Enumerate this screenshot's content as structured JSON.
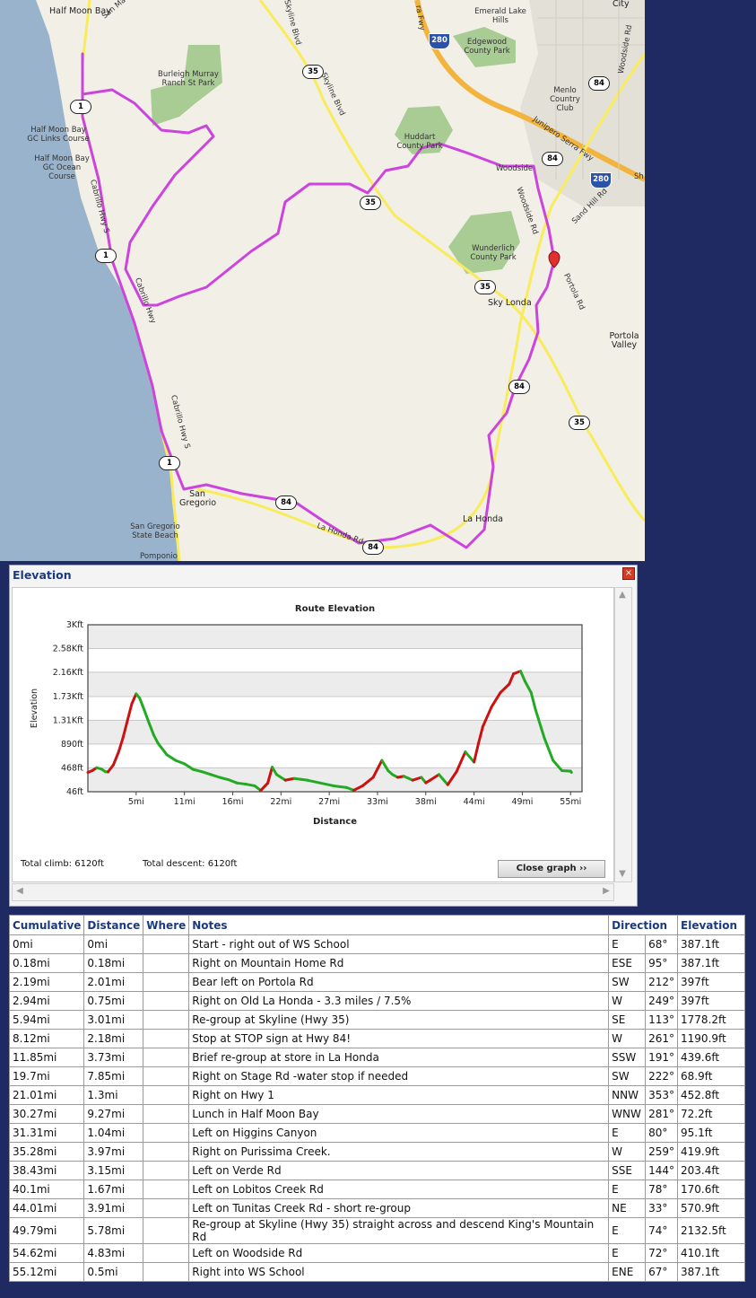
{
  "map": {
    "labels": {
      "half_moon_bay": "Half Moon Bay",
      "burleigh": "Burleigh Murray Ranch St Park",
      "hmb_gc_links": "Half Moon Bay GC Links Course",
      "hmb_gc_ocean": "Half Moon Bay GC Ocean Course",
      "emerald_lake_hills": "Emerald Lake Hills",
      "edgewood": "Edgewood County Park",
      "menlo_cc": "Menlo Country Club",
      "huddart": "Huddart County Park",
      "woodside": "Woodside",
      "wunderlich": "Wunderlich County Park",
      "sky_londa": "Sky Londa",
      "portola_valley": "Portola Valley",
      "san_gregorio": "San Gregorio",
      "sg_state_beach": "San Gregorio State Beach",
      "la_honda": "La Honda",
      "pomponio": "Pomponio",
      "city": "City",
      "sh": "Sh",
      "skyline_blvd": "Skyline Blvd",
      "woodside_rd": "Woodside Rd",
      "sand_hill_rd": "Sand Hill Rd",
      "junipero": "Junipero Serra Fwy",
      "portola_rd": "Portola Rd",
      "cabrillo_hwy_s": "Cabrillo Hwy S",
      "cabrillo_hwy": "Cabrillo Hwy",
      "la_honda_rd": "La Honda Rd",
      "san_mateo_rd": "San Mateo",
      "fwy": "ra Fwy"
    },
    "shields": {
      "s35a": "35",
      "s35b": "35",
      "s35c": "35",
      "s35d": "35",
      "s1a": "1",
      "s1b": "1",
      "s1c": "1",
      "s84a": "84",
      "s84b": "84",
      "s84c": "84",
      "s84d": "84",
      "s84e": "84",
      "i280a": "280",
      "i280b": "280"
    },
    "colors": {
      "route": "#cc44dd",
      "water": "#99b3cc",
      "park": "#8fbf7a",
      "freeway": "#f3b43e",
      "highway": "#f9ec5c",
      "land": "#f1efe6"
    }
  },
  "elevation_panel": {
    "title": "Elevation",
    "close_icon": "×",
    "total_climb": "Total climb: 6120ft",
    "total_descent": "Total descent: 6120ft",
    "close_button": "Close graph ››"
  },
  "chart_data": {
    "type": "line",
    "title": "Route Elevation",
    "xlabel": "Distance",
    "ylabel": "Elevation",
    "x_ticks": [
      "5mi",
      "11mi",
      "16mi",
      "22mi",
      "27mi",
      "33mi",
      "38mi",
      "44mi",
      "49mi",
      "55mi"
    ],
    "x_tick_values": [
      5.5,
      11,
      16.5,
      22,
      27.5,
      33,
      38.5,
      44,
      49.5,
      55
    ],
    "y_ticks": [
      "46ft",
      "468ft",
      "890ft",
      "1.31Kft",
      "1.73Kft",
      "2.16Kft",
      "2.58Kft",
      "3Kft"
    ],
    "y_tick_values": [
      46,
      468,
      890,
      1310,
      1730,
      2160,
      2580,
      3000
    ],
    "xlim": [
      0,
      56.3
    ],
    "ylim": [
      46,
      3000
    ],
    "grid": true,
    "colors": {
      "climb": "#cc1111",
      "descent": "#22aa22"
    },
    "x": [
      0,
      0.5,
      1,
      1.5,
      2,
      2.3,
      2.9,
      3.5,
      4,
      4.5,
      5,
      5.5,
      5.9,
      6.4,
      7,
      7.5,
      8,
      9,
      10,
      11,
      12,
      13,
      14,
      15,
      16,
      17,
      18,
      19,
      19.7,
      20.5,
      21,
      21.5,
      22.5,
      23.5,
      25,
      26.5,
      28,
      29.5,
      30.3,
      31.3,
      32.5,
      33.5,
      34.2,
      34.7,
      35.3,
      36,
      37,
      38,
      38.5,
      39,
      40,
      41,
      42,
      43,
      44,
      44.5,
      45,
      46,
      47,
      48,
      48.5,
      49.3,
      49.8,
      50.5,
      51,
      52,
      53,
      54,
      55,
      55.1
    ],
    "y": [
      387,
      420,
      470,
      450,
      400,
      397,
      520,
      750,
      1000,
      1300,
      1600,
      1778,
      1700,
      1500,
      1250,
      1050,
      900,
      700,
      600,
      540,
      440,
      400,
      350,
      300,
      260,
      200,
      180,
      150,
      69,
      200,
      480,
      350,
      250,
      280,
      250,
      200,
      150,
      120,
      72,
      150,
      300,
      600,
      420,
      350,
      300,
      320,
      250,
      300,
      204,
      250,
      350,
      171,
      400,
      750,
      571,
      900,
      1200,
      1550,
      1800,
      1950,
      2133,
      2180,
      2000,
      1800,
      1500,
      1000,
      600,
      420,
      410,
      387
    ]
  },
  "cue_sheet": {
    "headers": {
      "cumulative": "Cumulative",
      "distance": "Distance",
      "where": "Where",
      "notes": "Notes",
      "direction": "Direction",
      "elevation": "Elevation"
    },
    "rows": [
      [
        "0mi",
        "0mi",
        "",
        "Start - right out of WS School",
        "E",
        "68°",
        "387.1ft"
      ],
      [
        "0.18mi",
        "0.18mi",
        "",
        "Right on Mountain Home Rd",
        "ESE",
        "95°",
        "387.1ft"
      ],
      [
        "2.19mi",
        "2.01mi",
        "",
        "Bear left on Portola Rd",
        "SW",
        "212°",
        "397ft"
      ],
      [
        "2.94mi",
        "0.75mi",
        "",
        "Right on Old La Honda - 3.3 miles / 7.5%",
        "W",
        "249°",
        "397ft"
      ],
      [
        "5.94mi",
        "3.01mi",
        "",
        "Re-group at Skyline (Hwy 35)",
        "SE",
        "113°",
        "1778.2ft"
      ],
      [
        "8.12mi",
        "2.18mi",
        "",
        "Stop at STOP sign at Hwy 84!",
        "W",
        "261°",
        "1190.9ft"
      ],
      [
        "11.85mi",
        "3.73mi",
        "",
        "Brief re-group at store in La Honda",
        "SSW",
        "191°",
        "439.6ft"
      ],
      [
        "19.7mi",
        "7.85mi",
        "",
        "Right on Stage Rd -water stop if needed",
        "SW",
        "222°",
        "68.9ft"
      ],
      [
        "21.01mi",
        "1.3mi",
        "",
        "Right on Hwy 1",
        "NNW",
        "353°",
        "452.8ft"
      ],
      [
        "30.27mi",
        "9.27mi",
        "",
        "Lunch in Half Moon Bay",
        "WNW",
        "281°",
        "72.2ft"
      ],
      [
        "31.31mi",
        "1.04mi",
        "",
        "Left on Higgins Canyon",
        "E",
        "80°",
        "95.1ft"
      ],
      [
        "35.28mi",
        "3.97mi",
        "",
        "Right on Purissima Creek.",
        "W",
        "259°",
        "419.9ft"
      ],
      [
        "38.43mi",
        "3.15mi",
        "",
        "Left on Verde Rd",
        "SSE",
        "144°",
        "203.4ft"
      ],
      [
        "40.1mi",
        "1.67mi",
        "",
        "Left on Lobitos Creek Rd",
        "E",
        "78°",
        "170.6ft"
      ],
      [
        "44.01mi",
        "3.91mi",
        "",
        "Left on Tunitas Creek Rd - short re-group",
        "NE",
        "33°",
        "570.9ft"
      ],
      [
        "49.79mi",
        "5.78mi",
        "",
        "Re-group at Skyline (Hwy 35) straight across and descend King's Mountain Rd",
        "E",
        "74°",
        "2132.5ft"
      ],
      [
        "54.62mi",
        "4.83mi",
        "",
        "Left on Woodside Rd",
        "E",
        "72°",
        "410.1ft"
      ],
      [
        "55.12mi",
        "0.5mi",
        "",
        "Right into WS School",
        "ENE",
        "67°",
        "387.1ft"
      ]
    ]
  }
}
